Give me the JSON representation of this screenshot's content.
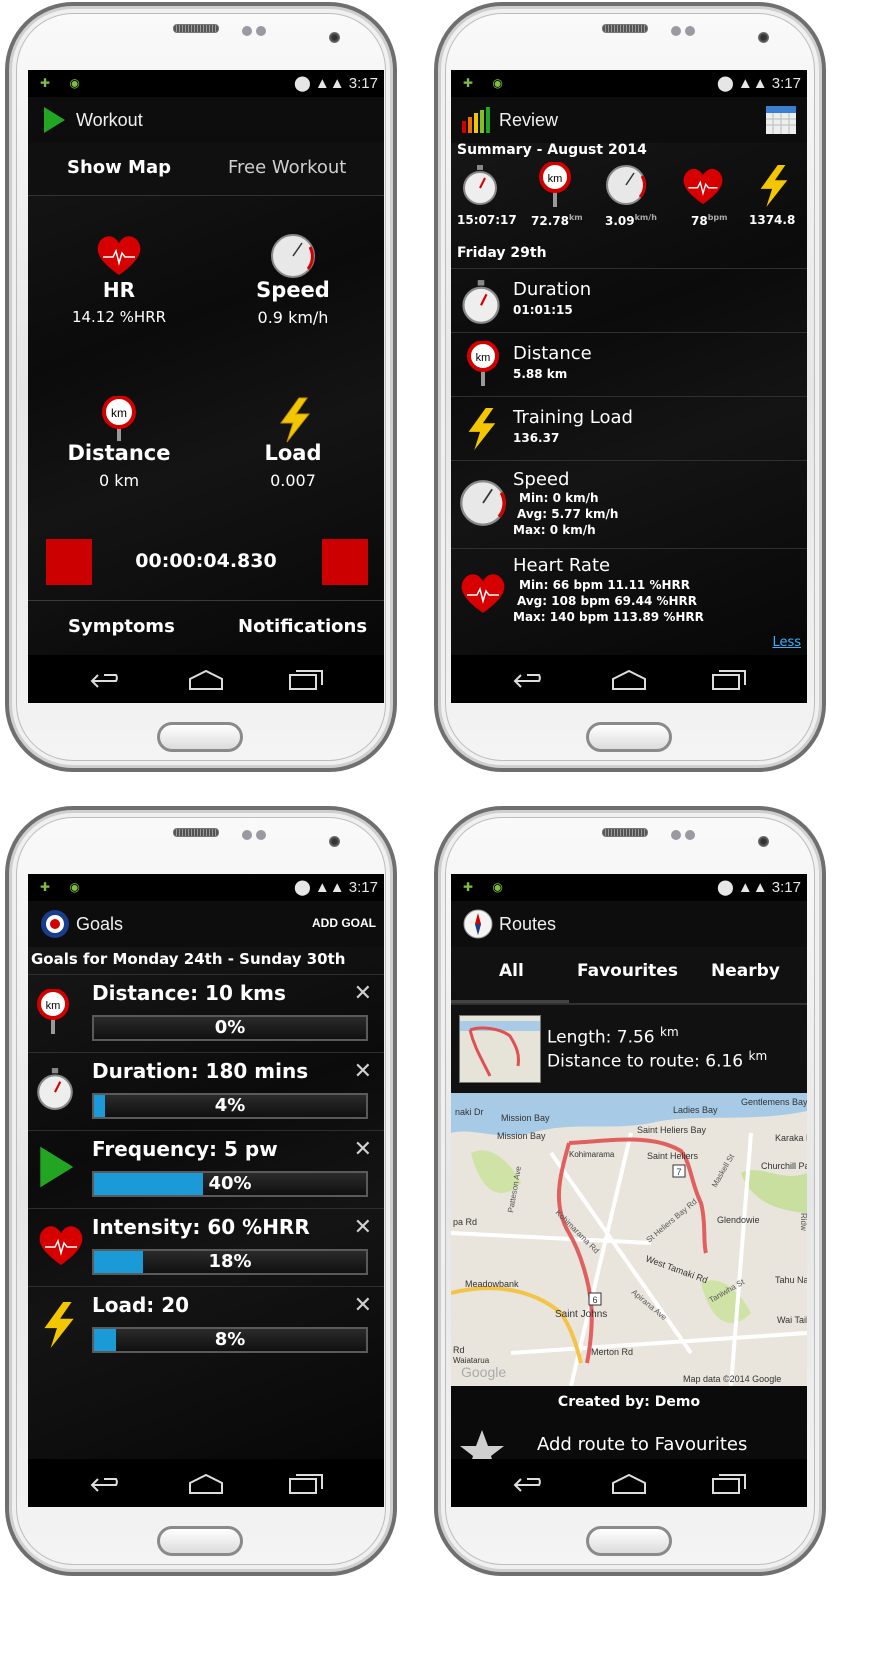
{
  "status_bar": {
    "time": "3:17"
  },
  "nav_icons": {
    "back": "back-arrow-icon",
    "home": "home-icon",
    "recent": "recent-apps-icon"
  },
  "workout": {
    "title": "Workout",
    "show_map": "Show Map",
    "free_workout": "Free Workout",
    "hr_label": "HR",
    "hr_value": "14.12 %HRR",
    "speed_label": "Speed",
    "speed_value": "0.9 km/h",
    "distance_label": "Distance",
    "distance_value": "0 km",
    "load_label": "Load",
    "load_value": "0.007",
    "timer": "00:00:04.830",
    "symptoms": "Symptoms",
    "notifications": "Notifications",
    "speed_gauge_unit": "km/h",
    "km_sign": "km"
  },
  "review": {
    "title": "Review",
    "summary_title": "Summary - August 2014",
    "summary": {
      "duration": "15:07:17",
      "distance": "72.78",
      "distance_unit": "km",
      "speed": "3.09",
      "speed_unit": "km/h",
      "hr": "78",
      "hr_unit": "bpm",
      "load": "1374.8"
    },
    "day_title": "Friday 29th",
    "duration_label": "Duration",
    "duration_value": "01:01:15",
    "distance_label": "Distance",
    "distance_value": "5.88 km",
    "load_label": "Training Load",
    "load_value": "136.37",
    "speed_label": "Speed",
    "speed_min": "Min: 0 km/h",
    "speed_avg": "Avg: 5.77 km/h",
    "speed_max": "Max: 0 km/h",
    "hr_label": "Heart Rate",
    "hr_min": "Min: 66 bpm  11.11 %HRR",
    "hr_avg": "Avg: 108 bpm  69.44 %HRR",
    "hr_max": "Max: 140 bpm  113.89 %HRR",
    "less_link": "Less"
  },
  "goals": {
    "title": "Goals",
    "add_goal": "ADD GOAL",
    "week_title": "Goals for Monday 24th - Sunday 30th",
    "items": [
      {
        "label": "Distance: 10 kms",
        "percent_text": "0%",
        "progress": 0.0,
        "icon": "km-sign-icon"
      },
      {
        "label": "Duration: 180 mins",
        "percent_text": "4%",
        "progress": 0.04,
        "icon": "stopwatch-icon"
      },
      {
        "label": "Frequency: 5 pw",
        "percent_text": "40%",
        "progress": 0.4,
        "icon": "play-icon"
      },
      {
        "label": "Intensity: 60 %HRR",
        "percent_text": "18%",
        "progress": 0.18,
        "icon": "heart-icon"
      },
      {
        "label": "Load: 20",
        "percent_text": "8%",
        "progress": 0.08,
        "icon": "lightning-icon"
      }
    ],
    "close_glyph": "✕"
  },
  "routes": {
    "title": "Routes",
    "tabs": [
      "All",
      "Favourites",
      "Nearby"
    ],
    "length_label": "Length: 7.56",
    "length_unit": "km",
    "distance_label": "Distance to route: 6.16",
    "distance_unit": "km",
    "map_labels": {
      "mission_bay": "Mission Bay",
      "mission_bay2": "Mission Bay",
      "ladies_bay": "Ladies Bay",
      "gentlemens_bay": "Gentlemens Bay",
      "saint_heliers_bay": "Saint Heliers Bay",
      "kohimarama": "Kohimarama",
      "saint_heliers": "Saint Heliers",
      "karaka_bay": "Karaka B",
      "churchill_park": "Churchill Park",
      "patteson_ave": "Patteson Ave",
      "maskell_st": "Maskell St",
      "glendowie": "Glendowie",
      "st_heliers_bay_rd": "St Heliers Bay Rd",
      "kohimarama_rd": "Kohimarama Rd",
      "pa_rd": "pa Rd",
      "west_tamaki_rd": "West Tamaki Rd",
      "meadowbank": "Meadowbank",
      "apirana_ave": "Apirana Ave",
      "saint_johns": "Saint Johns",
      "tamaki_rd": "Tamaki Rd",
      "merton_rd": "Merton Rd",
      "rd": "Rd",
      "waiatarua": "Waiatarua",
      "tahu_natur": "Tahu Natur",
      "wai_taik": "Wai Taiki",
      "taniwha_st": "Taniwha St",
      "ridwn": "Ridw",
      "kiaki_dr": "naki Dr",
      "map_data": "Map data ©2014 Google",
      "google": "Google",
      "route_7": "7",
      "route_6": "6"
    },
    "created_by": "Created by: Demo",
    "add_favourites": "Add route to Favourites"
  }
}
